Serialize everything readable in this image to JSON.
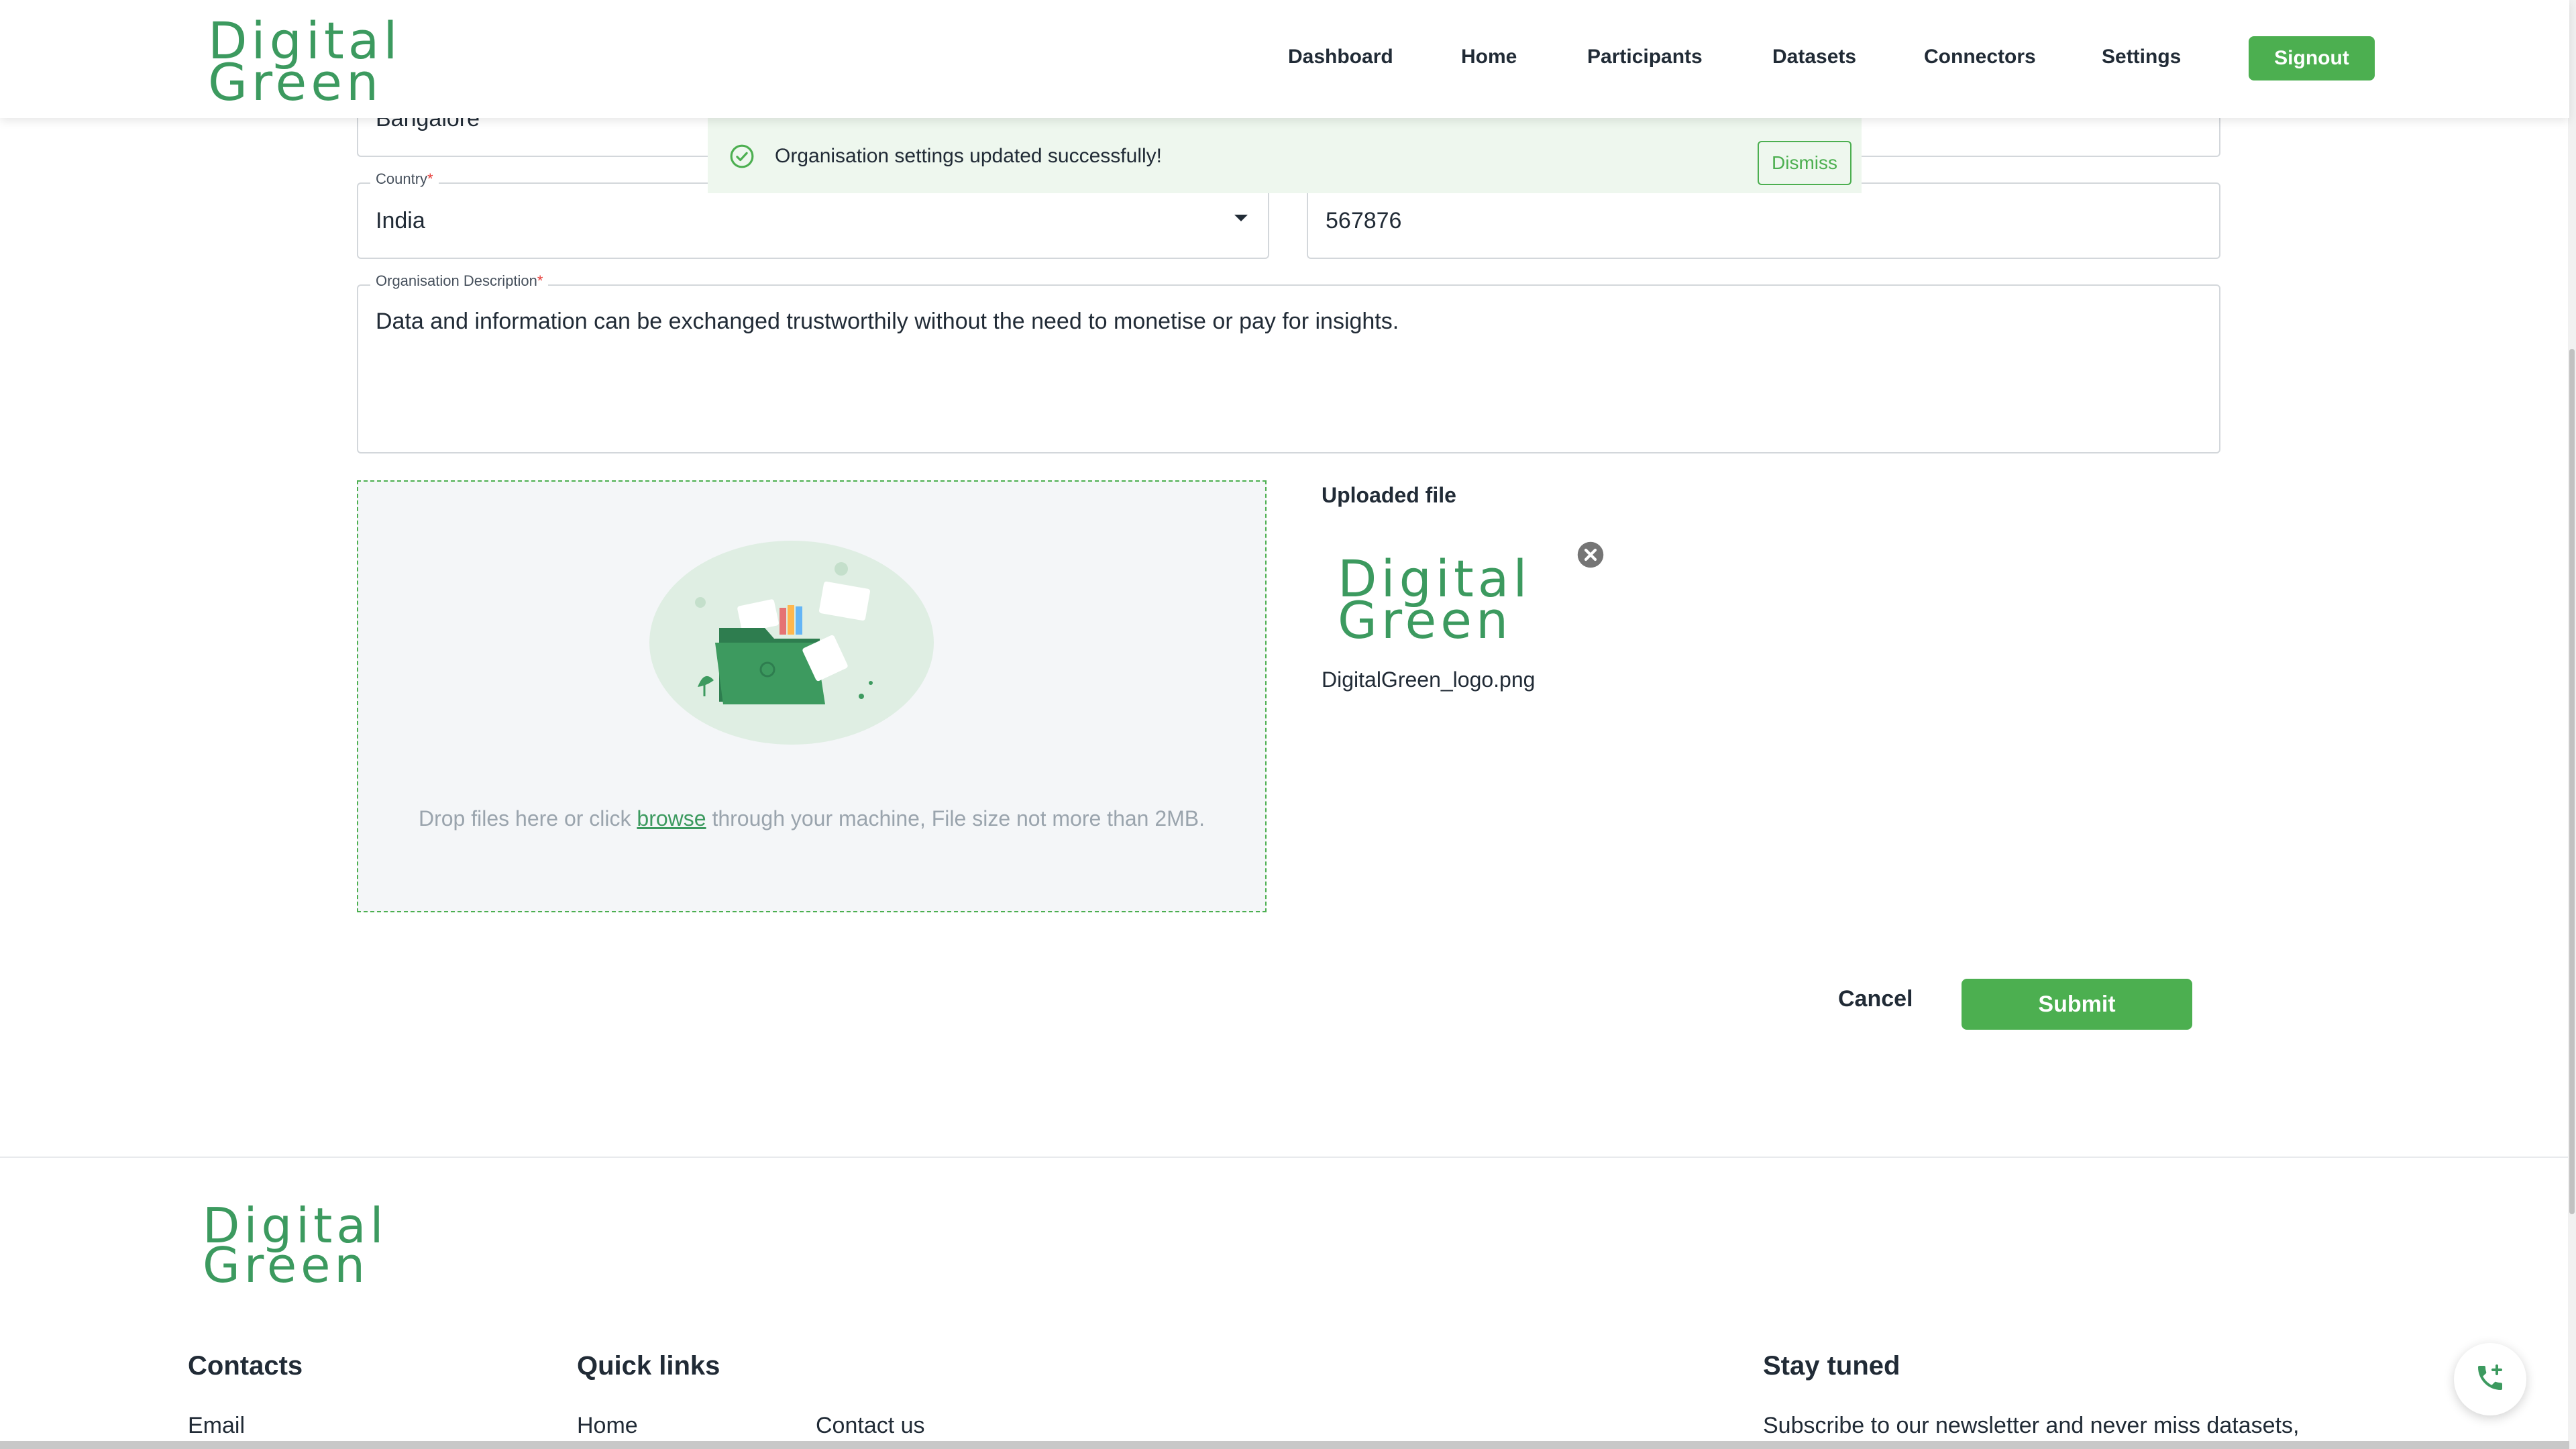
{
  "header": {
    "logo_line1": "Digital",
    "logo_line2": "Green",
    "nav": [
      "Dashboard",
      "Home",
      "Participants",
      "Datasets",
      "Connectors",
      "Settings"
    ],
    "signout_label": "Signout"
  },
  "toast": {
    "message": "Organisation settings updated successfully!",
    "dismiss_label": "Dismiss"
  },
  "form": {
    "city_value": "Bangalore",
    "country_label": "Country",
    "country_value": "India",
    "pincode_value": "567876",
    "description_label": "Organisation Description",
    "description_value": "Data and information can be exchanged trustworthily without the need to monetise or pay for insights.",
    "required_mark": "*"
  },
  "upload": {
    "drop_prefix": "Drop files here or click ",
    "browse_label": "browse",
    "drop_suffix": " through your machine, File size not more than 2MB.",
    "uploaded_heading": "Uploaded file",
    "preview_line1": "Digital",
    "preview_line2": "Green",
    "file_name": "DigitalGreen_logo.png"
  },
  "actions": {
    "cancel_label": "Cancel",
    "submit_label": "Submit"
  },
  "footer": {
    "logo_line1": "Digital",
    "logo_line2": "Green",
    "contacts_heading": "Contacts",
    "contacts_email": "Email",
    "quick_links_heading": "Quick links",
    "quick_links": [
      "Home",
      "Contact us"
    ],
    "stay_tuned_heading": "Stay tuned",
    "stay_tuned_text": "Subscribe to our newsletter and never miss datasets,"
  },
  "colors": {
    "brand_green": "#4caf50",
    "logo_green": "#3c9a5f",
    "toast_bg": "#eef7ee"
  },
  "icons": {
    "toast": "check-circle-icon",
    "dropdown": "caret-down-icon",
    "remove": "close-circle-icon",
    "fab": "phone-add-icon"
  }
}
